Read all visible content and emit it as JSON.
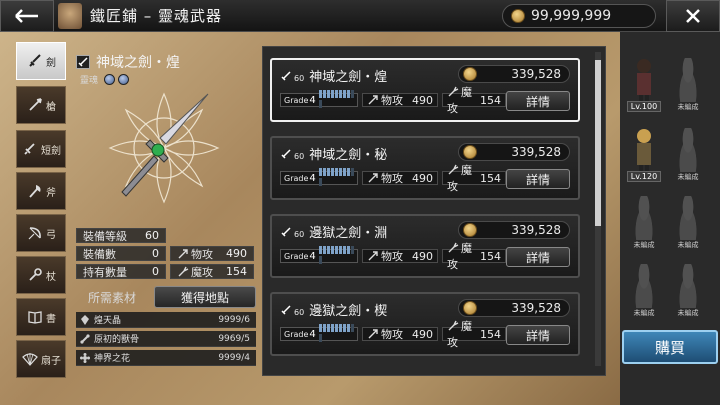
{
  "header": {
    "title": "鐵匠鋪 – 靈魂武器",
    "currency": "99,999,999",
    "back_icon": "back-arrow-icon",
    "close_icon": "close-icon"
  },
  "categories": [
    {
      "label": "劍",
      "icon": "sword-icon",
      "active": true
    },
    {
      "label": "槍",
      "icon": "spear-icon",
      "active": false
    },
    {
      "label": "短劍",
      "icon": "dagger-icon",
      "active": false
    },
    {
      "label": "斧",
      "icon": "axe-icon",
      "active": false
    },
    {
      "label": "弓",
      "icon": "bow-icon",
      "active": false
    },
    {
      "label": "杖",
      "icon": "staff-icon",
      "active": false
    },
    {
      "label": "書",
      "icon": "book-icon",
      "active": false
    },
    {
      "label": "扇子",
      "icon": "fan-icon",
      "active": false
    }
  ],
  "detail": {
    "name": "神域之劍・煌",
    "soul_label": "靈魂",
    "equip_level_label": "裝備等級",
    "equip_level": "60",
    "equip_count_label": "裝備數",
    "equip_count": "0",
    "held_count_label": "持有數量",
    "held_count": "0",
    "phys_label": "物攻",
    "phys_value": "490",
    "mag_label": "魔攻",
    "mag_value": "154",
    "materials_title": "所需素材",
    "obtain_button": "獲得地點",
    "materials": [
      {
        "name": "煌天晶",
        "count": "9999/6",
        "icon": "crystal-icon"
      },
      {
        "name": "原初的獸骨",
        "count": "9969/5",
        "icon": "bone-icon"
      },
      {
        "name": "神界之花",
        "count": "9999/4",
        "icon": "flower-icon"
      }
    ]
  },
  "weapons": [
    {
      "level": "60",
      "name": "神域之劍・煌",
      "price": "339,528",
      "grade_label": "Grade",
      "grade": "4",
      "grade_fill": 0.8,
      "phys_label": "物攻",
      "phys": "490",
      "mag_label": "魔攻",
      "mag": "154",
      "detail_button": "詳情",
      "selected": true
    },
    {
      "level": "60",
      "name": "神域之劍・秘",
      "price": "339,528",
      "grade_label": "Grade",
      "grade": "4",
      "grade_fill": 0.8,
      "phys_label": "物攻",
      "phys": "490",
      "mag_label": "魔攻",
      "mag": "154",
      "detail_button": "詳情",
      "selected": false
    },
    {
      "level": "60",
      "name": "邊獄之劍・淵",
      "price": "339,528",
      "grade_label": "Grade",
      "grade": "4",
      "grade_fill": 0.8,
      "phys_label": "物攻",
      "phys": "490",
      "mag_label": "魔攻",
      "mag": "154",
      "detail_button": "詳情",
      "selected": false
    },
    {
      "level": "60",
      "name": "邊獄之劍・楔",
      "price": "339,528",
      "grade_label": "Grade",
      "grade": "4",
      "grade_fill": 0.8,
      "phys_label": "物攻",
      "phys": "490",
      "mag_label": "魔攻",
      "mag": "154",
      "detail_button": "詳情",
      "selected": false
    }
  ],
  "party": {
    "heroes": [
      {
        "label": "Lv.100"
      },
      {
        "label": "Lv.120"
      }
    ],
    "empty_label": "未編成",
    "buy_button": "購買"
  },
  "colors": {
    "accent_blue": "#2f6f9e",
    "parchment": "#b89a6c",
    "selected_border": "#f0f0f0"
  }
}
